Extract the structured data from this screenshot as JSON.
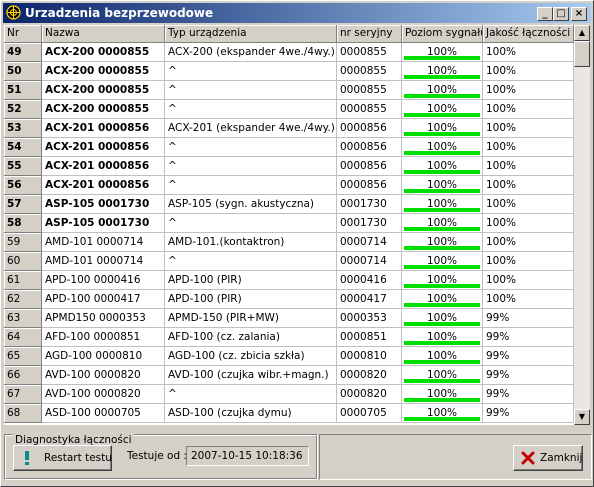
{
  "window": {
    "title": "Urzadzenia bezprzewodowe"
  },
  "columns": [
    "Nr",
    "Nazwa",
    "Typ urządzenia",
    "nr seryjny",
    "Poziom sygnału",
    "Jakość łączności"
  ],
  "rows": [
    {
      "nr": "49",
      "name": "ACX-200 0000855",
      "type": "ACX-200 (ekspander 4we./4wy.)",
      "serial": "0000855",
      "signal": "100%",
      "quality": "100%",
      "bold": true,
      "level": 100
    },
    {
      "nr": "50",
      "name": "ACX-200 0000855",
      "type": "^",
      "serial": "0000855",
      "signal": "100%",
      "quality": "100%",
      "bold": true,
      "level": 100
    },
    {
      "nr": "51",
      "name": "ACX-200 0000855",
      "type": "^",
      "serial": "0000855",
      "signal": "100%",
      "quality": "100%",
      "bold": true,
      "level": 100
    },
    {
      "nr": "52",
      "name": "ACX-200 0000855",
      "type": "^",
      "serial": "0000855",
      "signal": "100%",
      "quality": "100%",
      "bold": true,
      "level": 100
    },
    {
      "nr": "53",
      "name": "ACX-201 0000856",
      "type": "ACX-201 (ekspander 4we./4wy.)",
      "serial": "0000856",
      "signal": "100%",
      "quality": "100%",
      "bold": true,
      "level": 100
    },
    {
      "nr": "54",
      "name": "ACX-201 0000856",
      "type": "^",
      "serial": "0000856",
      "signal": "100%",
      "quality": "100%",
      "bold": true,
      "level": 100
    },
    {
      "nr": "55",
      "name": "ACX-201 0000856",
      "type": "^",
      "serial": "0000856",
      "signal": "100%",
      "quality": "100%",
      "bold": true,
      "level": 100
    },
    {
      "nr": "56",
      "name": "ACX-201 0000856",
      "type": "^",
      "serial": "0000856",
      "signal": "100%",
      "quality": "100%",
      "bold": true,
      "level": 100
    },
    {
      "nr": "57",
      "name": "ASP-105 0001730",
      "type": "ASP-105 (sygn. akustyczna)",
      "serial": "0001730",
      "signal": "100%",
      "quality": "100%",
      "bold": true,
      "level": 100
    },
    {
      "nr": "58",
      "name": "ASP-105 0001730",
      "type": "^",
      "serial": "0001730",
      "signal": "100%",
      "quality": "100%",
      "bold": true,
      "level": 100
    },
    {
      "nr": "59",
      "name": "AMD-101 0000714",
      "type": "AMD-101.(kontaktron)",
      "serial": "0000714",
      "signal": "100%",
      "quality": "100%",
      "bold": false,
      "level": 100
    },
    {
      "nr": "60",
      "name": "AMD-101 0000714",
      "type": "^",
      "serial": "0000714",
      "signal": "100%",
      "quality": "100%",
      "bold": false,
      "level": 100
    },
    {
      "nr": "61",
      "name": "APD-100 0000416",
      "type": "APD-100 (PIR)",
      "serial": "0000416",
      "signal": "100%",
      "quality": "100%",
      "bold": false,
      "level": 100
    },
    {
      "nr": "62",
      "name": "APD-100 0000417",
      "type": "APD-100 (PIR)",
      "serial": "0000417",
      "signal": "100%",
      "quality": "100%",
      "bold": false,
      "level": 100
    },
    {
      "nr": "63",
      "name": "APMD150 0000353",
      "type": "APMD-150 (PIR+MW)",
      "serial": "0000353",
      "signal": "100%",
      "quality": "99%",
      "bold": false,
      "level": 100
    },
    {
      "nr": "64",
      "name": "AFD-100 0000851",
      "type": "AFD-100 (cz. zalania)",
      "serial": "0000851",
      "signal": "100%",
      "quality": "99%",
      "bold": false,
      "level": 100
    },
    {
      "nr": "65",
      "name": "AGD-100 0000810",
      "type": "AGD-100 (cz. zbicia szkła)",
      "serial": "0000810",
      "signal": "100%",
      "quality": "99%",
      "bold": false,
      "level": 100
    },
    {
      "nr": "66",
      "name": "AVD-100 0000820",
      "type": "AVD-100 (czujka wibr.+magn.)",
      "serial": "0000820",
      "signal": "100%",
      "quality": "99%",
      "bold": false,
      "level": 100
    },
    {
      "nr": "67",
      "name": "AVD-100 0000820",
      "type": "^",
      "serial": "0000820",
      "signal": "100%",
      "quality": "99%",
      "bold": false,
      "level": 100
    },
    {
      "nr": "68",
      "name": "ASD-100 0000705",
      "type": "ASD-100 (czujka dymu)",
      "serial": "0000705",
      "signal": "100%",
      "quality": "99%",
      "bold": false,
      "level": 100
    }
  ],
  "diagnostics": {
    "group_label": "Diagnostyka łączności",
    "restart_label": "Restart testu",
    "testing_since_label": "Testuje od :",
    "testing_since_value": "2007-10-15 10:18:36"
  },
  "close_label": "Zamknij",
  "icons": {
    "app": "radar-icon",
    "restart": "exclamation-icon",
    "close": "red-x-icon",
    "signal_bar_color": "#00e000"
  }
}
